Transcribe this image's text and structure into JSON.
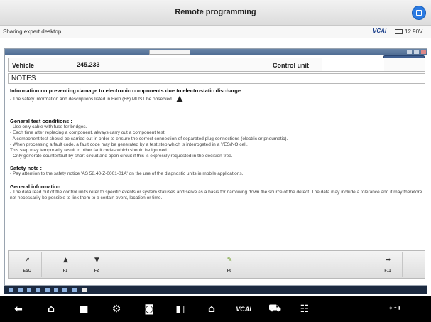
{
  "window": {
    "title": "Remote programming"
  },
  "status": {
    "sharing": "Sharing expert desktop",
    "vci": "VCAl",
    "voltage": "12.90V"
  },
  "vehicle_row": {
    "vehicle_label": "Vehicle",
    "vehicle_value": "245.233",
    "control_unit_label": "Control unit",
    "control_unit_value": ""
  },
  "notes_title": "NOTES",
  "document": {
    "esd_heading": "Information on preventing damage to electronic components due to electrostatic discharge :",
    "esd_text": "- The safety information and descriptions listed in Help (F6) MUST be observed.",
    "general_heading": "General test conditions :",
    "general_lines": [
      "- Use only cable with fuse for bridges.",
      "- Each time after replacing a component, always carry out a component test.",
      "- A component test should be carried out in order to ensure the correct connection of separated plug connections (electric or pneumatic).",
      "- When processing a fault code, a fault code may be generated by a test step which is interrogated in a YES/NO cell.",
      "  This step may temporarily result in other fault codes which should be ignored.",
      "- Only generate counterfault by short circuit and open circuit if this is expressly requested in the decision tree."
    ],
    "safety_heading": "Safety note :",
    "safety_text": "- Pay attention to the safety notice 'AS 58.40-Z-0001-01A' on the use of the diagnostic units in mobile applications.",
    "info_heading": "General information :",
    "info_text": "- The data read out of the control units refer to specific events or system statuses and serve as a basis for narrowing down the source of the defect. The data may include a tolerance and it may therefore not necessarily be possible to link them to a certain event, location or time."
  },
  "function_keys": [
    {
      "label": "ESC",
      "icon": "exit-icon"
    },
    {
      "label": "F1",
      "icon": "arrow-up-icon"
    },
    {
      "label": "F2",
      "icon": "arrow-down-icon"
    },
    {
      "label": "F6",
      "icon": "help-bulb-icon"
    },
    {
      "label": "F11",
      "icon": "tool-icon"
    }
  ],
  "navbar": {
    "vci_label": "VCAl"
  },
  "colors": {
    "accent": "#2a7ae2",
    "remote_title": "#4d6a91",
    "navbar": "#000000"
  }
}
